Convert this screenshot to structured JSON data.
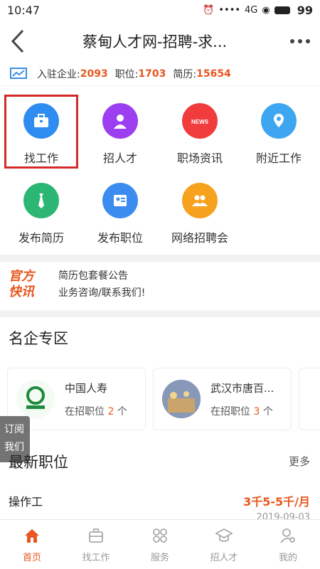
{
  "status_bar": {
    "time": "10:47",
    "signal_text": "4G",
    "battery": "99"
  },
  "nav": {
    "title": "蔡甸人才网-招聘-求..."
  },
  "stats": {
    "companies_label": "入驻企业:",
    "companies_value": "2093",
    "jobs_label": "职位:",
    "jobs_value": "1703",
    "resumes_label": "简历:",
    "resumes_value": "15654"
  },
  "grid": [
    {
      "label": "找工作",
      "icon": "briefcase-icon",
      "color": "#2f8cf0"
    },
    {
      "label": "招人才",
      "icon": "person-icon",
      "color": "#9c3ff0"
    },
    {
      "label": "职场资讯",
      "icon": "news-icon",
      "color": "#f03c3c"
    },
    {
      "label": "附近工作",
      "icon": "location-icon",
      "color": "#3ea6f0"
    },
    {
      "label": "发布简历",
      "icon": "tie-icon",
      "color": "#2bb673"
    },
    {
      "label": "发布职位",
      "icon": "id-card-icon",
      "color": "#3c8cf0"
    },
    {
      "label": "网络招聘会",
      "icon": "group-icon",
      "color": "#f6a21e"
    }
  ],
  "news": {
    "badge_line1": "官方",
    "badge_line2": "快讯",
    "items": [
      "简历包套餐公告",
      "业务咨询/联系我们!"
    ]
  },
  "famous": {
    "title": "名企专区",
    "companies": [
      {
        "name": "中国人寿",
        "jobs_prefix": "在招职位",
        "jobs_count": "2",
        "jobs_suffix": "个"
      },
      {
        "name": "武汉市唐百...",
        "jobs_prefix": "在招职位",
        "jobs_count": "3",
        "jobs_suffix": "个"
      }
    ]
  },
  "subscribe": {
    "line1": "订阅",
    "line2": "我们"
  },
  "latest": {
    "title": "最新职位",
    "more": "更多",
    "jobs": [
      {
        "title": "操作工",
        "salary": "3千5-5千/月",
        "date": "2019-09-03"
      }
    ]
  },
  "tabbar": [
    {
      "label": "首页",
      "icon": "home-icon",
      "active": true
    },
    {
      "label": "找工作",
      "icon": "briefcase-icon",
      "active": false
    },
    {
      "label": "服务",
      "icon": "apps-icon",
      "active": false
    },
    {
      "label": "招人才",
      "icon": "graduation-cap-icon",
      "active": false
    },
    {
      "label": "我的",
      "icon": "user-settings-icon",
      "active": false
    }
  ],
  "colors": {
    "accent": "#e8571f",
    "highlight_border": "#d22a2a"
  }
}
